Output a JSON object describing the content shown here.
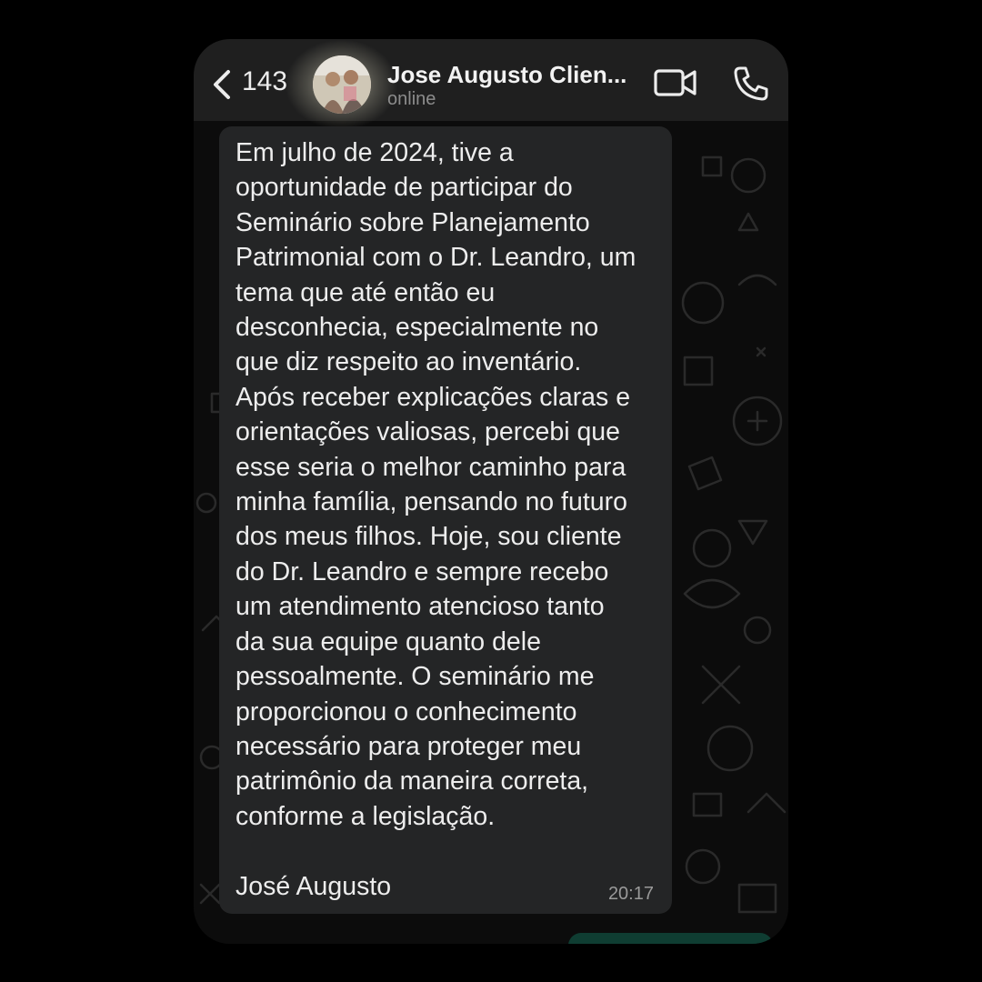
{
  "header": {
    "back_count": "143",
    "contact_name": "Jose Augusto Clien...",
    "status": "online"
  },
  "icons": {
    "back": "chevron-left-icon",
    "video": "video-camera-icon",
    "call": "phone-icon"
  },
  "message": {
    "text": "Em julho de 2024, tive a\noportunidade de participar do\nSeminário sobre Planejamento\nPatrimonial com o Dr. Leandro, um\ntema que até então eu\ndesconhecia, especialmente no\nque diz respeito ao inventário.\nApós receber explicações claras e\norientações valiosas, percebi que\nesse seria o melhor caminho para\nminha família, pensando no futuro\ndos meus filhos. Hoje, sou cliente\ndo Dr. Leandro e sempre recebo\num atendimento atencioso tanto\nda sua equipe quanto dele\npessoalmente. O seminário me\nproporcionou o conhecimento\nnecessário para proteger meu\npatrimônio da maneira correta,\nconforme a legislação.\n\nJosé Augusto",
    "time": "20:17"
  },
  "colors": {
    "header_bg": "#1f1f1f",
    "chat_bg": "#0c0c0c",
    "incoming_bubble": "#242526",
    "outgoing_bubble": "#0f3d32",
    "text": "#ededed",
    "muted": "#8c8c8c"
  }
}
